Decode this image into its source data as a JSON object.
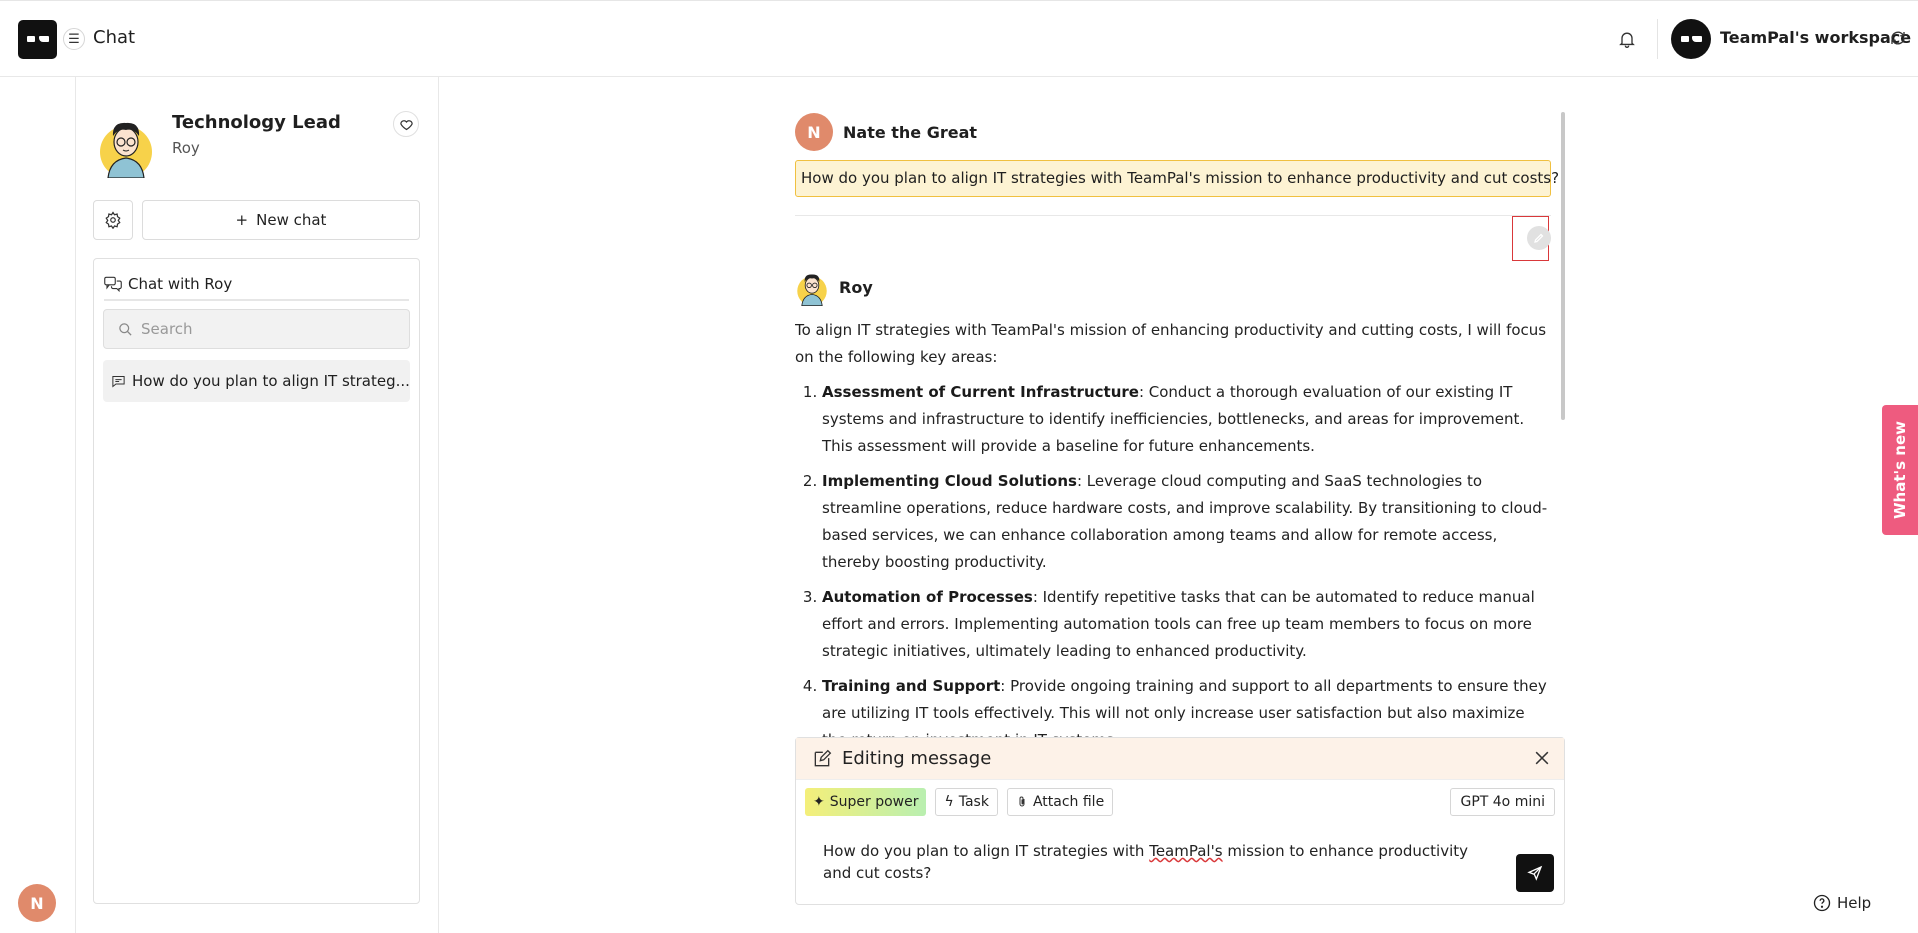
{
  "app": {
    "title": "Chat",
    "workspace_name": "TeamPal's workspace",
    "user_initial": "N"
  },
  "agent": {
    "title": "Technology Lead",
    "name": "Roy",
    "new_chat_label": "New chat"
  },
  "chat_list": {
    "heading": "Chat with Roy",
    "search_placeholder": "Search",
    "items": [
      {
        "label": "How do you plan to align IT strateg..."
      }
    ]
  },
  "conversation": {
    "user": {
      "name": "Nate the Great",
      "initial": "N",
      "message": "How do you plan to align IT strategies with TeamPal's mission to enhance productivity and cut costs?"
    },
    "assistant": {
      "name": "Roy",
      "intro": "To align IT strategies with TeamPal's mission of enhancing productivity and cutting costs, I will focus on the following key areas:",
      "points": [
        {
          "title": "Assessment of Current Infrastructure",
          "text": ": Conduct a thorough evaluation of our existing IT systems and infrastructure to identify inefficiencies, bottlenecks, and areas for improvement. This assessment will provide a baseline for future enhancements."
        },
        {
          "title": "Implementing Cloud Solutions",
          "text": ": Leverage cloud computing and SaaS technologies to streamline operations, reduce hardware costs, and improve scalability. By transitioning to cloud-based services, we can enhance collaboration among teams and allow for remote access, thereby boosting productivity."
        },
        {
          "title": "Automation of Processes",
          "text": ": Identify repetitive tasks that can be automated to reduce manual effort and errors. Implementing automation tools can free up team members to focus on more strategic initiatives, ultimately leading to enhanced productivity."
        },
        {
          "title": "Training and Support",
          "text": ": Provide ongoing training and support to all departments to ensure they are utilizing IT tools effectively. This will not only increase user satisfaction but also maximize the return on investment in IT systems."
        }
      ]
    }
  },
  "composer": {
    "banner": "Editing message",
    "super_power": "Super power",
    "task": "Task",
    "attach": "Attach file",
    "model": "GPT 4o mini",
    "text_before": "How do you plan to align IT strategies with ",
    "text_typo": "TeamPal's",
    "text_after": " mission to enhance productivity and cut costs?"
  },
  "whats_new": "What's new",
  "help": "Help",
  "colors": {
    "accent_pink": "#ee5b7f",
    "user_avatar": "#e08a6b",
    "highlight_bg": "#fdf3d3",
    "highlight_border": "#f0c040"
  }
}
